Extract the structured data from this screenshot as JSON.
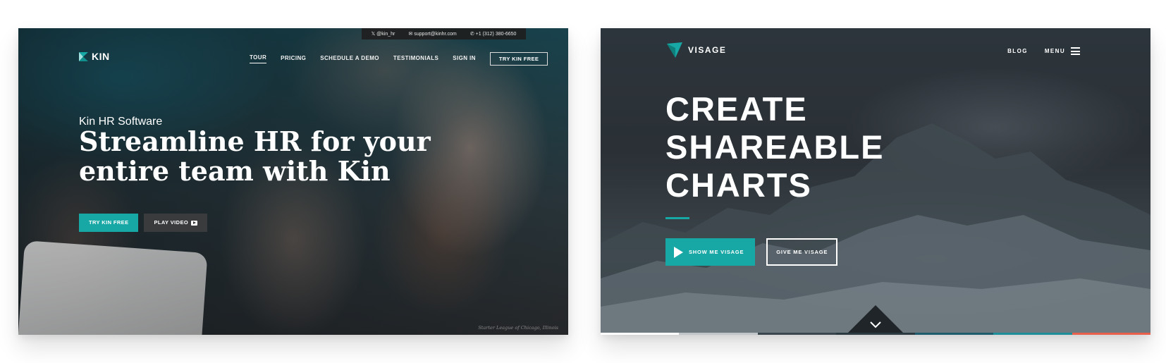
{
  "kin": {
    "topbar": {
      "twitter": "@kin_hr",
      "email": "support@kinhr.com",
      "phone": "+1 (312) 380-6650"
    },
    "logo_text": "KIN",
    "nav": [
      "TOUR",
      "PRICING",
      "SCHEDULE A DEMO",
      "TESTIMONIALS",
      "SIGN IN"
    ],
    "nav_cta": "TRY KIN FREE",
    "eyebrow": "Kin HR Software",
    "headline_line1": "Streamline HR for your",
    "headline_line2": "entire team with Kin",
    "primary_button": "TRY KIN FREE",
    "secondary_button": "PLAY VIDEO",
    "credit": "Starter League of Chicago, Illinois",
    "accent_color": "#17a8a5"
  },
  "visage": {
    "logo_text": "VISAGE",
    "nav_blog": "BLOG",
    "nav_menu": "MENU",
    "headline": [
      "CREATE",
      "SHAREABLE",
      "CHARTS"
    ],
    "primary_button": "SHOW ME VISAGE",
    "secondary_button": "GIVE ME VISAGE",
    "accent_color": "#17a8a5",
    "strip_colors": [
      "#ffffff",
      "#bfc5c9",
      "#3b474e",
      "#2c3a42",
      "#1f5d6e",
      "#1d8e9a",
      "#e8604c"
    ]
  }
}
